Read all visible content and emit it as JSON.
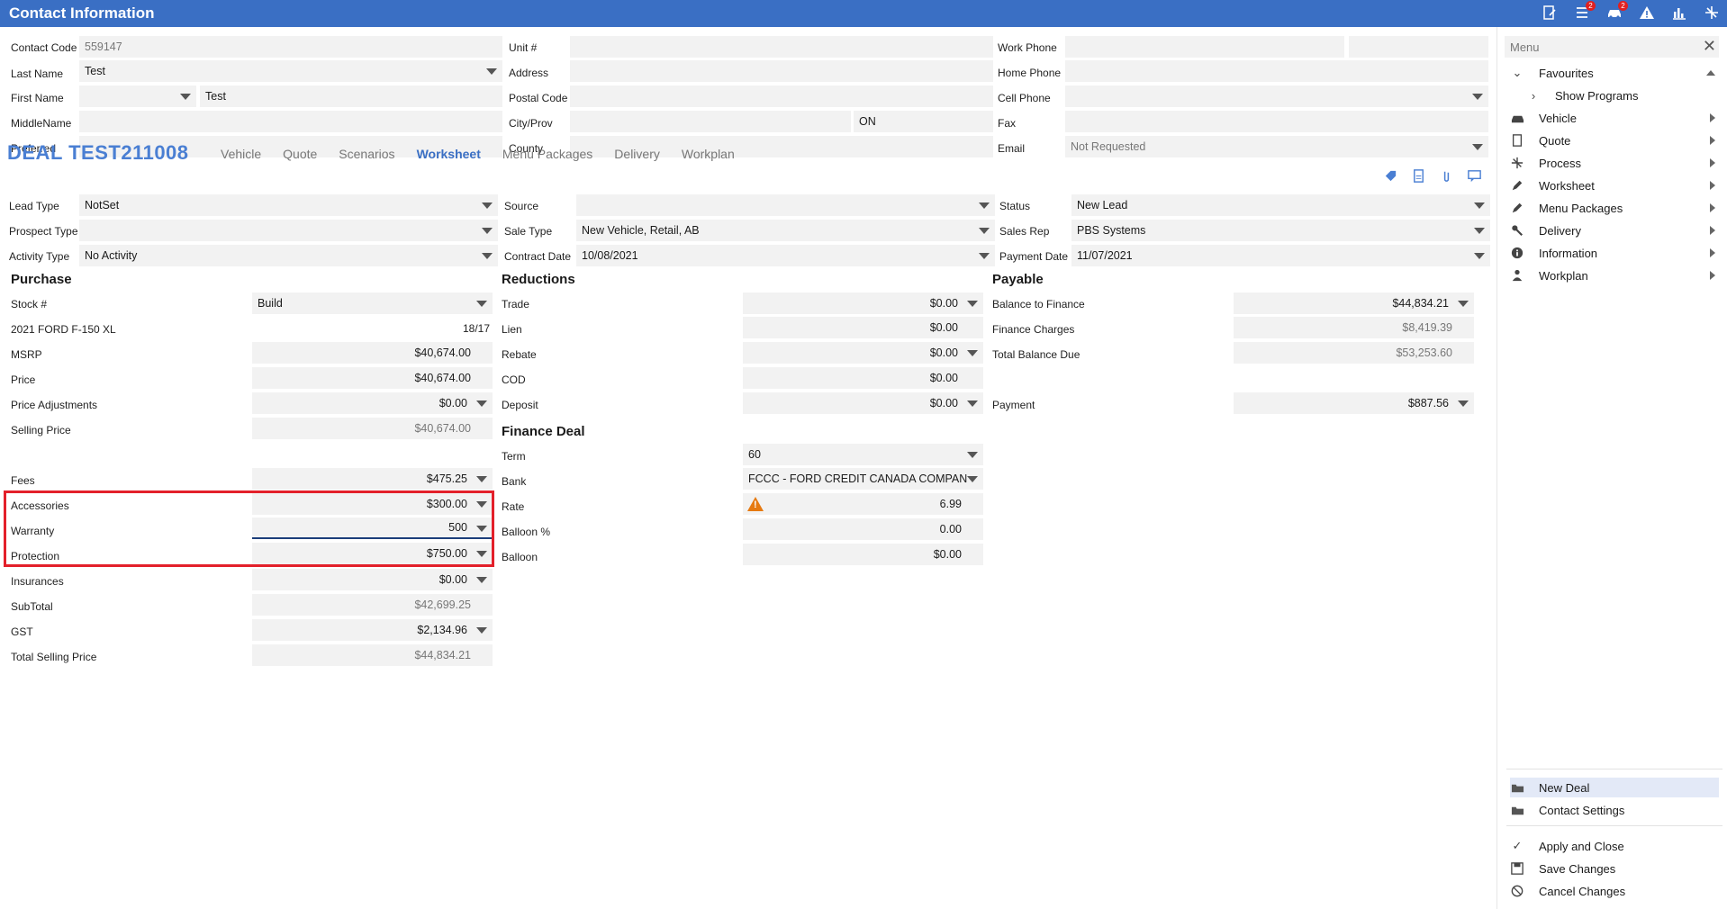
{
  "window": {
    "title": "Contact Information",
    "badges": {
      "list": "2",
      "car": "2"
    }
  },
  "contact": {
    "contact_code": {
      "label": "Contact Code",
      "value": "559147"
    },
    "last_name": {
      "label": "Last Name",
      "value": "Test"
    },
    "first_name": {
      "label": "First Name",
      "prefix": "",
      "value": "Test"
    },
    "middle_name": {
      "label": "MiddleName",
      "value": ""
    },
    "preferred": {
      "label": "Preferred",
      "value": ""
    },
    "unit": {
      "label": "Unit #",
      "value": ""
    },
    "address": {
      "label": "Address",
      "value": ""
    },
    "postal_code": {
      "label": "Postal Code",
      "value": ""
    },
    "city_prov": {
      "label": "City/Prov",
      "city": "",
      "prov": "ON"
    },
    "county": {
      "label": "County",
      "value": ""
    },
    "work_phone": {
      "label": "Work Phone",
      "value": "",
      "ext": ""
    },
    "home_phone": {
      "label": "Home Phone",
      "value": ""
    },
    "cell_phone": {
      "label": "Cell Phone",
      "value": ""
    },
    "fax": {
      "label": "Fax",
      "value": ""
    },
    "email": {
      "label": "Email",
      "value": "Not Requested"
    }
  },
  "deal": {
    "title": "DEAL TEST211008",
    "tabs": [
      "Vehicle",
      "Quote",
      "Scenarios",
      "Worksheet",
      "Menu Packages",
      "Delivery",
      "Workplan"
    ],
    "active_tab": "Worksheet",
    "lead_type": {
      "label": "Lead Type",
      "value": "NotSet"
    },
    "prospect_type": {
      "label": "Prospect Type",
      "value": ""
    },
    "activity_type": {
      "label": "Activity Type",
      "value": "No Activity"
    },
    "source": {
      "label": "Source",
      "value": ""
    },
    "sale_type": {
      "label": "Sale Type",
      "value": "New Vehicle, Retail, AB"
    },
    "contract_date": {
      "label": "Contract Date",
      "value": "10/08/2021"
    },
    "status": {
      "label": "Status",
      "value": "New Lead"
    },
    "sales_rep": {
      "label": "Sales Rep",
      "value": "PBS Systems"
    },
    "payment_date": {
      "label": "Payment Date",
      "value": "11/07/2021"
    }
  },
  "purchase": {
    "heading": "Purchase",
    "stock": {
      "label": "Stock #",
      "value": "Build"
    },
    "vehicle": {
      "label": "2021 FORD F-150 XL",
      "value": "18/17"
    },
    "msrp": {
      "label": "MSRP",
      "value": "$40,674.00"
    },
    "price": {
      "label": "Price",
      "value": "$40,674.00"
    },
    "price_adjustments": {
      "label": "Price Adjustments",
      "value": "$0.00"
    },
    "selling_price": {
      "label": "Selling Price",
      "value": "$40,674.00"
    },
    "fees": {
      "label": "Fees",
      "value": "$475.25"
    },
    "accessories": {
      "label": "Accessories",
      "value": "$300.00"
    },
    "warranty": {
      "label": "Warranty",
      "value": "500"
    },
    "protection": {
      "label": "Protection",
      "value": "$750.00"
    },
    "insurances": {
      "label": "Insurances",
      "value": "$0.00"
    },
    "subtotal": {
      "label": "SubTotal",
      "value": "$42,699.25"
    },
    "gst": {
      "label": "GST",
      "value": "$2,134.96"
    },
    "total_selling_price": {
      "label": "Total Selling Price",
      "value": "$44,834.21"
    }
  },
  "reductions": {
    "heading": "Reductions",
    "trade": {
      "label": "Trade",
      "value": "$0.00"
    },
    "lien": {
      "label": "Lien",
      "value": "$0.00"
    },
    "rebate": {
      "label": "Rebate",
      "value": "$0.00"
    },
    "cod": {
      "label": "COD",
      "value": "$0.00"
    },
    "deposit": {
      "label": "Deposit",
      "value": "$0.00"
    }
  },
  "finance": {
    "heading": "Finance Deal",
    "term": {
      "label": "Term",
      "value": "60"
    },
    "bank": {
      "label": "Bank",
      "value": "FCCC - FORD CREDIT CANADA COMPAN"
    },
    "rate": {
      "label": "Rate",
      "value": "6.99"
    },
    "balloon_pct": {
      "label": "Balloon %",
      "value": "0.00"
    },
    "balloon": {
      "label": "Balloon",
      "value": "$0.00"
    }
  },
  "payable": {
    "heading": "Payable",
    "balance_to_finance": {
      "label": "Balance to Finance",
      "value": "$44,834.21"
    },
    "finance_charges": {
      "label": "Finance Charges",
      "value": "$8,419.39"
    },
    "total_balance_due": {
      "label": "Total Balance Due",
      "value": "$53,253.60"
    },
    "payment": {
      "label": "Payment",
      "value": "$887.56"
    }
  },
  "sidebar": {
    "search_placeholder": "Menu",
    "items": [
      {
        "label": "Favourites",
        "icon": "chevron-down-icon"
      },
      {
        "label": "Show Programs",
        "icon": "chevron-right-icon"
      },
      {
        "label": "Vehicle",
        "icon": "car-icon"
      },
      {
        "label": "Quote",
        "icon": "document-icon"
      },
      {
        "label": "Process",
        "icon": "process-icon"
      },
      {
        "label": "Worksheet",
        "icon": "pencil-icon"
      },
      {
        "label": "Menu Packages",
        "icon": "pencil-icon"
      },
      {
        "label": "Delivery",
        "icon": "wrench-icon"
      },
      {
        "label": "Information",
        "icon": "info-icon"
      },
      {
        "label": "Workplan",
        "icon": "person-icon"
      }
    ],
    "bottom": {
      "new_deal": "New Deal",
      "contact_settings": "Contact Settings",
      "apply_close": "Apply and Close",
      "save_changes": "Save Changes",
      "cancel_changes": "Cancel Changes"
    }
  }
}
